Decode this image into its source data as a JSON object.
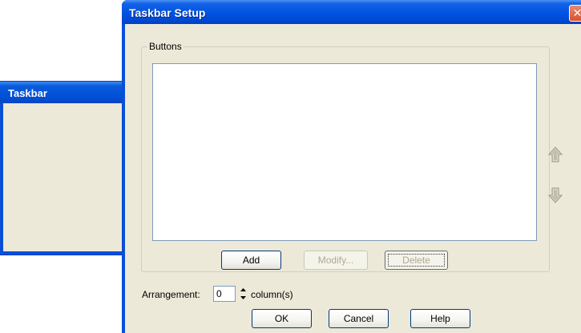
{
  "background_window": {
    "title": "Taskbar"
  },
  "dialog": {
    "title": "Taskbar Setup",
    "close_label": "✕",
    "buttons_group": {
      "label": "Buttons",
      "list_items": [],
      "move_up_icon": "arrow-up-icon",
      "move_down_icon": "arrow-down-icon"
    },
    "actions": {
      "add_label": "Add",
      "modify_label": "Modify...",
      "delete_label": "Delete"
    },
    "arrangement": {
      "label": "Arrangement:",
      "value": "0",
      "unit_label": "column(s)"
    },
    "footer": {
      "ok_label": "OK",
      "cancel_label": "Cancel",
      "help_label": "Help"
    }
  },
  "colors": {
    "title_bar": "#0054e3",
    "dialog_bg": "#ece9d8",
    "close_button": "#d9532f"
  }
}
